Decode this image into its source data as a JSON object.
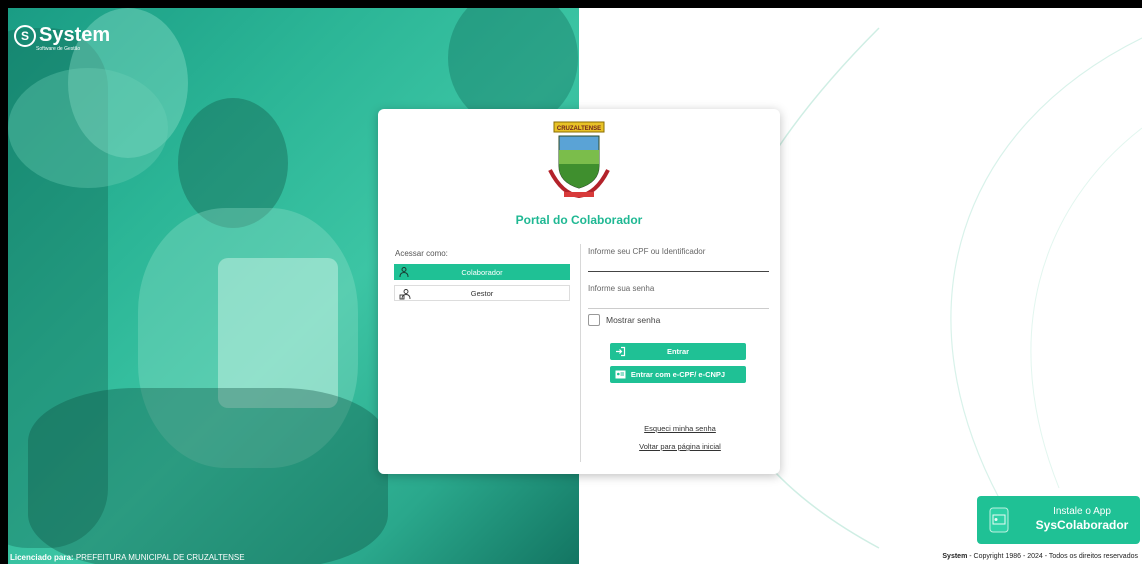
{
  "brand": {
    "name": "System",
    "tagline": "Software de Gestão"
  },
  "portal": {
    "title": "Portal do Colaborador",
    "crest_banner": "CRUZALTENSE"
  },
  "access": {
    "label": "Acessar como:",
    "roles": [
      {
        "label": "Colaborador",
        "icon": "users-icon",
        "selected": true
      },
      {
        "label": "Gestor",
        "icon": "manager-icon",
        "selected": false
      }
    ]
  },
  "form": {
    "cpf_label": "Informe seu CPF ou Identificador",
    "password_label": "Informe sua senha",
    "show_password_label": "Mostrar senha",
    "enter_label": "Entrar",
    "ecpf_label": "Entrar com e-CPF/ e-CNPJ",
    "forgot_label": "Esqueci minha senha",
    "back_label": "Voltar para página inicial"
  },
  "footer": {
    "licensed_prefix": "Licenciado para:",
    "licensed_to": "PREFEITURA MUNICIPAL DE CRUZALTENSE",
    "copyright_brand": "System",
    "copyright_text": "- Copyright 1986 - 2024 - Todos os direitos reservados"
  },
  "app_promo": {
    "line1": "Instale o App",
    "line2": "SysColaborador"
  },
  "colors": {
    "accent": "#1fc195",
    "title": "#1fb893"
  }
}
